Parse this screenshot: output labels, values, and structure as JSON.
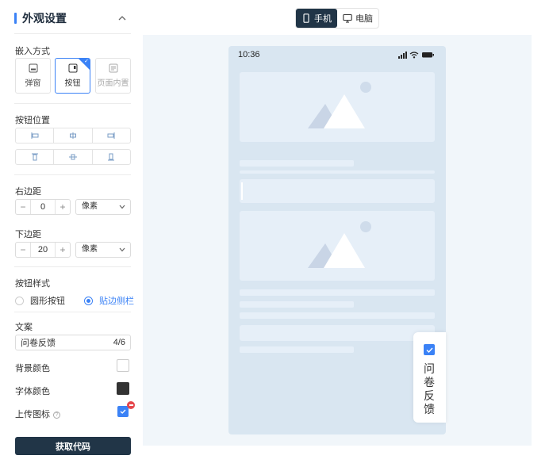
{
  "panel": {
    "title": "外观设置",
    "embed_label": "嵌入方式",
    "embed_options": [
      {
        "label": "弹窗",
        "icon": "popup-icon"
      },
      {
        "label": "按钮",
        "icon": "button-icon",
        "selected": true
      },
      {
        "label": "页面内置",
        "icon": "page-embed-icon"
      }
    ],
    "position_label": "按钮位置",
    "right_margin_label": "右边距",
    "right_margin_value": "0",
    "bottom_margin_label": "下边距",
    "bottom_margin_value": "20",
    "unit_value": "像素",
    "style_label": "按钮样式",
    "style_options": [
      "圆形按钮",
      "贴边侧栏"
    ],
    "style_selected": "贴边侧栏",
    "copy_label": "文案",
    "copy_value": "问卷反馈",
    "copy_count": "4/6",
    "bg_color_label": "背景颜色",
    "bg_color": "#ffffff",
    "font_color_label": "字体颜色",
    "font_color": "#333333",
    "upload_icon_label": "上传图标",
    "get_code_label": "获取代码"
  },
  "device_toggle": {
    "phone_label": "手机",
    "desktop_label": "电脑",
    "selected": "手机"
  },
  "phone": {
    "time": "10:36"
  },
  "feedback_button": {
    "text": "问卷反馈"
  },
  "colors": {
    "accent": "#3b82f6",
    "dark": "#213547",
    "preview_bg": "#f1f6fa",
    "phone_bg": "#d9e6f1"
  }
}
